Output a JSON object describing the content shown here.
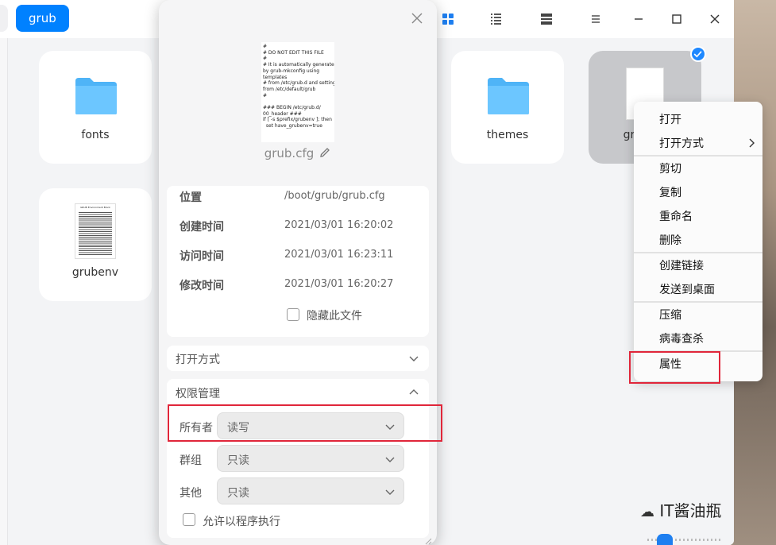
{
  "breadcrumb": {
    "current": "grub"
  },
  "toolbar": {
    "icons": [
      "grid-view-icon",
      "list-view-icon",
      "detail-view-icon",
      "menu-icon",
      "minimize-icon",
      "maximize-icon",
      "close-icon"
    ]
  },
  "files": [
    {
      "name": "fonts",
      "kind": "folder"
    },
    {
      "name": "themes",
      "kind": "folder"
    },
    {
      "name": "gr",
      "kind": "file",
      "selected": true
    },
    {
      "name": "grubenv",
      "kind": "file"
    }
  ],
  "grubenv_thumb": {
    "title": "GRUB Environment Block"
  },
  "dialog": {
    "preview_text": "#\n# DO NOT EDIT THIS FILE\n#\n# It is automatically generated\nby grub-mkconfig using\ntemplates\n# from /etc/grub.d and settings\nfrom /etc/default/grub\n#\n\n### BEGIN /etc/grub.d/\n00_header ###\nif [ -s $prefix/grubenv ]; then\n  set have_grubenv=true",
    "filename": "grub.cfg",
    "info": [
      {
        "key": "位置",
        "value": "/boot/grub/grub.cfg"
      },
      {
        "key": "创建时间",
        "value": "2021/03/01 16:20:02"
      },
      {
        "key": "访问时间",
        "value": "2021/03/01 16:23:11"
      },
      {
        "key": "修改时间",
        "value": "2021/03/01 16:20:27"
      }
    ],
    "hide_file_label": "隐藏此文件",
    "open_with_label": "打开方式",
    "permissions": {
      "title": "权限管理",
      "rows": [
        {
          "label": "所有者",
          "value": "读写"
        },
        {
          "label": "群组",
          "value": "只读"
        },
        {
          "label": "其他",
          "value": "只读"
        }
      ],
      "allow_exec_label": "允许以程序执行"
    }
  },
  "context_menu": {
    "items": [
      "打开",
      "打开方式",
      "剪切",
      "复制",
      "重命名",
      "删除",
      "创建链接",
      "发送到桌面",
      "压缩",
      "病毒查杀",
      "属性"
    ]
  },
  "watermark": "IT酱油瓶",
  "colors": {
    "accent": "#0081ff",
    "highlight": "#e0263a"
  }
}
